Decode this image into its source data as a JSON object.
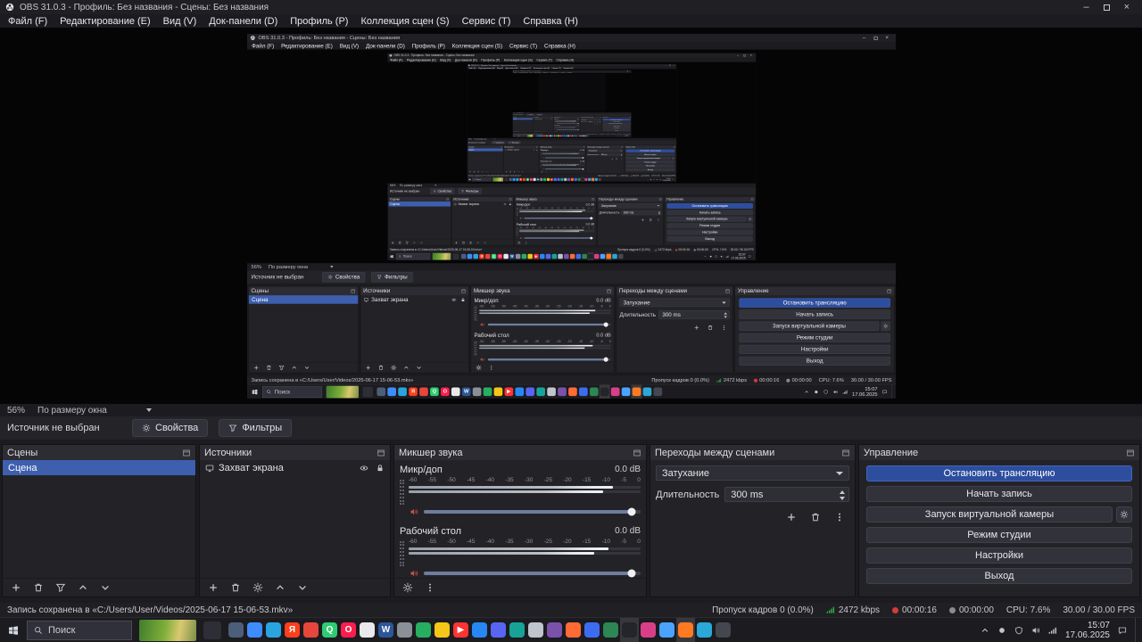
{
  "colors": {
    "accent_blue": "#3d5fae",
    "live_red": "#d83a3a",
    "bitrate_green": "#33b249",
    "muted_speaker_red": "#c4524e",
    "active_app_orange": "#ff7a21"
  },
  "window": {
    "title": "OBS 31.0.3 - Профиль: Без названия - Сцены: Без названия",
    "controls": {
      "minimize": "–",
      "close": "×"
    },
    "menu": [
      "Файл (F)",
      "Редактирование (E)",
      "Вид (V)",
      "Док-панели (D)",
      "Профиль (P)",
      "Коллекция сцен (S)",
      "Сервис (T)",
      "Справка (H)"
    ]
  },
  "preview": {
    "zoom_value": "56%",
    "zoom_mode": "По размеру окна"
  },
  "source_toolbar": {
    "no_source": "Источник не выбран",
    "properties": "Свойства",
    "filters": "Фильтры"
  },
  "docks": {
    "scenes": {
      "title": "Сцены",
      "items": [
        "Сцена"
      ]
    },
    "sources": {
      "title": "Источники",
      "items": [
        "Захват экрана"
      ]
    },
    "mixer": {
      "title": "Микшер звука",
      "scale": [
        "-60",
        "-55",
        "-50",
        "-45",
        "-40",
        "-35",
        "-30",
        "-25",
        "-20",
        "-15",
        "-10",
        "-5",
        "0"
      ],
      "channels": [
        {
          "name": "Микр/доп",
          "db": "0.0 dB"
        },
        {
          "name": "Рабочий стол",
          "db": "0.0 dB"
        }
      ]
    },
    "transitions": {
      "title": "Переходы между сценами",
      "selected": "Затухание",
      "duration_label": "Длительность",
      "duration_value": "300 ms"
    },
    "controls": {
      "title": "Управление",
      "stop_stream": "Остановить трансляцию",
      "start_record": "Начать запись",
      "virtual_camera": "Запуск виртуальной камеры",
      "studio_mode": "Режим студии",
      "settings": "Настройки",
      "exit": "Выход"
    }
  },
  "status_bar": {
    "message": "Запись сохранена в «C:/Users/User/Videos/2025-06-17 15-06-53.mkv»",
    "dropped_frames": "Пропуск кадров 0 (0.0%)",
    "bitrate": "2472 kbps",
    "stream_time": "00:00:16",
    "record_time": "00:00:00",
    "cpu": "CPU: 7.6%",
    "fps": "30.00 / 30.00 FPS"
  },
  "taskbar": {
    "search_placeholder": "Поиск",
    "clock_time": "15:07",
    "clock_date": "17.06.2025",
    "apps": [
      {
        "c": "#4d5e78",
        "g": ""
      },
      {
        "c": "#3f8cff",
        "g": ""
      },
      {
        "c": "#2aa4e0",
        "g": ""
      },
      {
        "c": "#fc3f1d",
        "g": "Я"
      },
      {
        "c": "#e8453c",
        "g": ""
      },
      {
        "c": "#2ecc71",
        "g": "Q"
      },
      {
        "c": "#fa1e4e",
        "g": "O"
      },
      {
        "c": "#e9e9ec",
        "g": ""
      },
      {
        "c": "#2b579a",
        "g": "W"
      },
      {
        "c": "#8a8f98",
        "g": ""
      },
      {
        "c": "#27ae60",
        "g": ""
      },
      {
        "c": "#f5c518",
        "g": ""
      },
      {
        "c": "#ff3333",
        "g": "▶"
      },
      {
        "c": "#2787f5",
        "g": ""
      },
      {
        "c": "#5865f2",
        "g": ""
      },
      {
        "c": "#17a398",
        "g": ""
      },
      {
        "c": "#c0c4cc",
        "g": ""
      },
      {
        "c": "#7b52ab",
        "g": ""
      },
      {
        "c": "#ff6b35",
        "g": ""
      },
      {
        "c": "#3c6df0",
        "g": ""
      },
      {
        "c": "#2d8653",
        "g": ""
      },
      {
        "c": "#24252a",
        "g": "",
        "hl": true
      },
      {
        "c": "#d93f87",
        "g": ""
      },
      {
        "c": "#4aa3ff",
        "g": ""
      },
      {
        "c": "#ff7a21",
        "g": "",
        "hl": true
      },
      {
        "c": "#2aa8d8",
        "g": ""
      },
      {
        "c": "#44474f",
        "g": ""
      }
    ]
  }
}
